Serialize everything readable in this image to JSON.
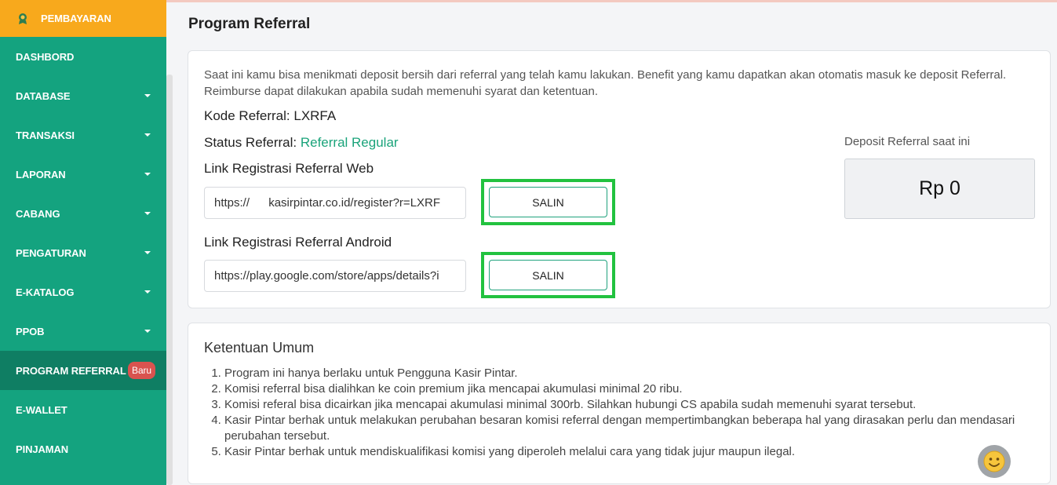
{
  "sidebar": {
    "top_item": "PEMBAYARAN",
    "items": [
      {
        "label": "DASHBORD",
        "caret": false
      },
      {
        "label": "DATABASE",
        "caret": true
      },
      {
        "label": "TRANSAKSI",
        "caret": true
      },
      {
        "label": "LAPORAN",
        "caret": true
      },
      {
        "label": "CABANG",
        "caret": true
      },
      {
        "label": "PENGATURAN",
        "caret": true
      },
      {
        "label": "E-KATALOG",
        "caret": true
      },
      {
        "label": "PPOB",
        "caret": true
      },
      {
        "label": "PROGRAM REFERRAL",
        "caret": false,
        "badge": "Baru",
        "active": true
      },
      {
        "label": "E-WALLET",
        "caret": false
      },
      {
        "label": "PINJAMAN",
        "caret": false
      }
    ]
  },
  "page": {
    "title": "Program Referral"
  },
  "referral": {
    "description": "Saat ini kamu bisa menikmati deposit bersih dari referral yang telah kamu lakukan. Benefit yang kamu dapatkan akan otomatis masuk ke deposit Referral. Reimburse dapat dilakukan apabila sudah memenuhi syarat dan ketentuan.",
    "kode_label": "Kode Referral:",
    "kode_value": "LXRFA",
    "status_label": "Status Referral:",
    "status_value": "Referral Regular",
    "web_label": "Link Registrasi Referral Web",
    "web_link": "https:// kasirpintar.co.id/register?r=LXRF",
    "android_label": "Link Registrasi Referral Android",
    "android_link": "https://play.google.com/store/apps/details?i",
    "copy_label": "SALIN",
    "deposit_label": "Deposit Referral saat ini",
    "deposit_value": "Rp 0"
  },
  "ketentuan": {
    "title": "Ketentuan Umum",
    "items": [
      "Program ini hanya berlaku untuk Pengguna Kasir Pintar.",
      "Komisi referral bisa dialihkan ke coin premium jika mencapai akumulasi minimal 20 ribu.",
      "Komisi referal bisa dicairkan jika mencapai akumulasi minimal 300rb. Silahkan hubungi CS apabila sudah memenuhi syarat tersebut.",
      "Kasir Pintar berhak untuk melakukan perubahan besaran komisi referral dengan mempertimbangkan beberapa hal yang dirasakan perlu dan mendasari perubahan tersebut.",
      "Kasir Pintar berhak untuk mendiskualifikasi komisi yang diperoleh melalui cara yang tidak jujur maupun ilegal."
    ]
  },
  "colors": {
    "sidebar": "#14a37f",
    "sidebar_active": "#0f7e63",
    "top_item": "#f8a91c",
    "badge": "#d9534f",
    "highlight": "#22c23f",
    "status_text": "#1aa37a"
  },
  "icons": {
    "payment": "payment-icon",
    "caret": "chevron-down-icon",
    "chat": "smiley-icon"
  }
}
